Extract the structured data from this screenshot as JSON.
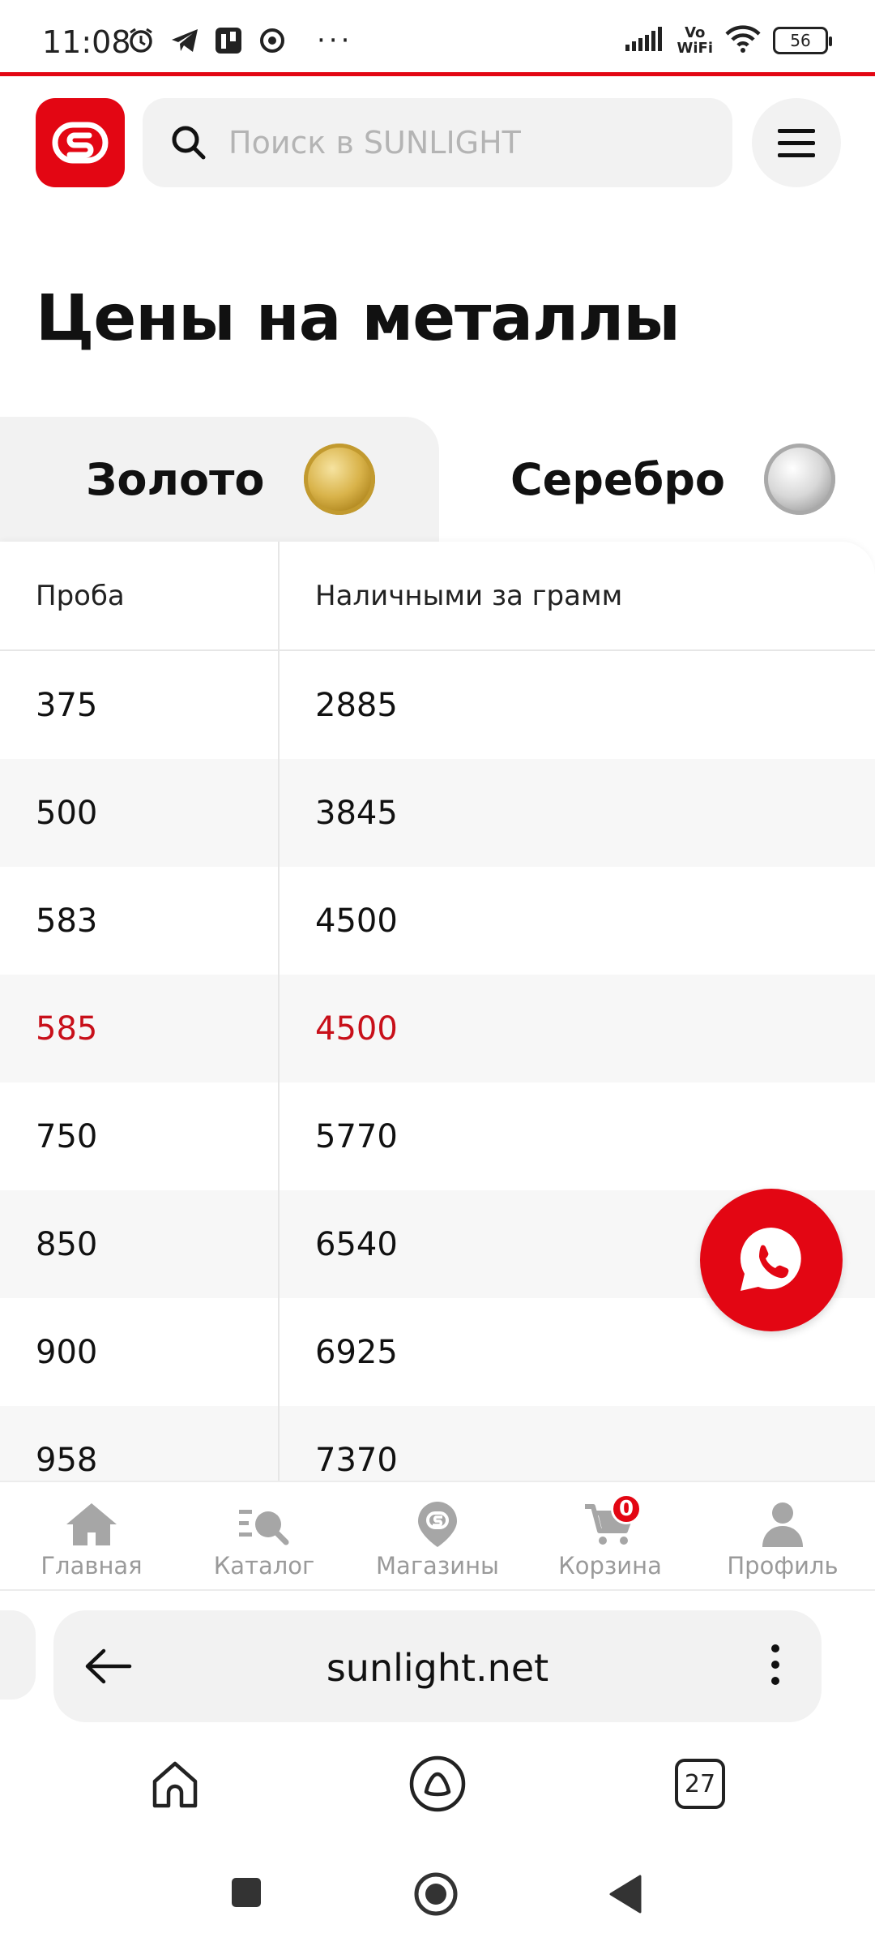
{
  "status_bar": {
    "time": "11:08",
    "wifi_label_top": "Vo",
    "wifi_label_bottom": "WiFi",
    "battery": "56",
    "overflow": "···"
  },
  "header": {
    "search_placeholder": "Поиск в SUNLIGHT"
  },
  "page_title": "Цены на металлы",
  "tabs": [
    {
      "label": "Золото",
      "active": true
    },
    {
      "label": "Серебро",
      "active": false
    }
  ],
  "table": {
    "headers": [
      "Проба",
      "Наличными за грамм"
    ],
    "rows": [
      {
        "proba": "375",
        "price": "2885"
      },
      {
        "proba": "500",
        "price": "3845"
      },
      {
        "proba": "583",
        "price": "4500"
      },
      {
        "proba": "585",
        "price": "4500",
        "highlight": true
      },
      {
        "proba": "750",
        "price": "5770"
      },
      {
        "proba": "850",
        "price": "6540"
      },
      {
        "proba": "900",
        "price": "6925"
      },
      {
        "proba": "958",
        "price": "7370"
      }
    ],
    "highlight_color": "#c8101a"
  },
  "bottom_nav": {
    "items": [
      {
        "label": "Главная",
        "icon": "home-icon"
      },
      {
        "label": "Каталог",
        "icon": "catalog-search-icon"
      },
      {
        "label": "Магазины",
        "icon": "map-pin-icon"
      },
      {
        "label": "Корзина",
        "icon": "cart-icon",
        "badge": "0"
      },
      {
        "label": "Профиль",
        "icon": "profile-icon"
      }
    ]
  },
  "browser": {
    "url": "sunlight.net",
    "tabs_count": "27"
  },
  "colors": {
    "brand": "#e30613",
    "muted": "#9a9a9a",
    "surface": "#f2f2f2"
  }
}
